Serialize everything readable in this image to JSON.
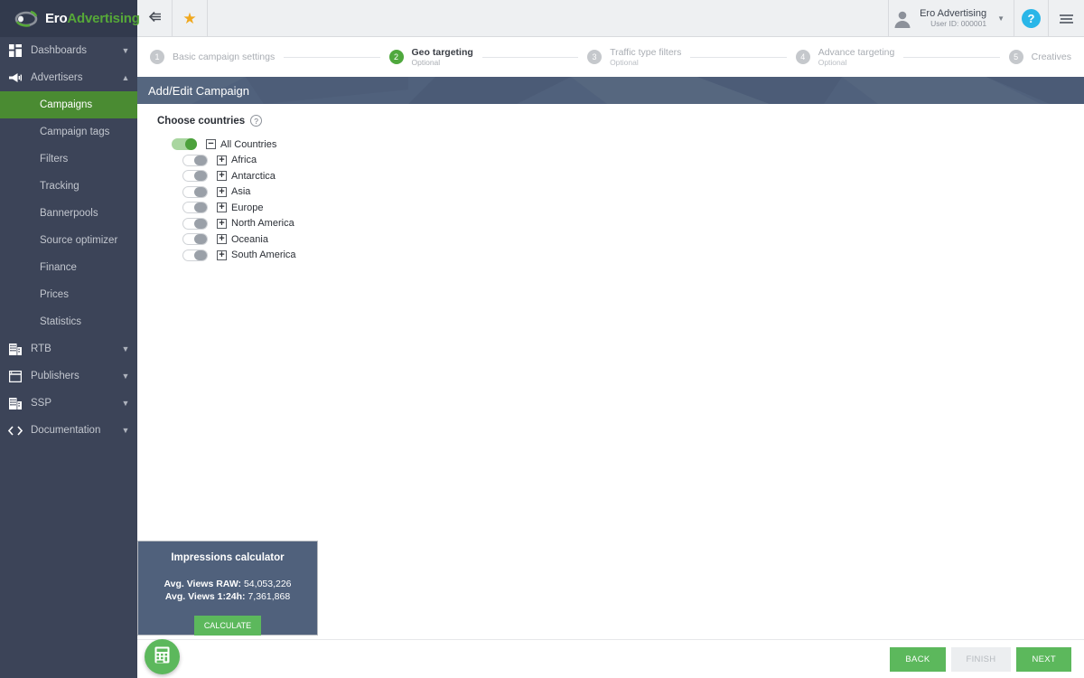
{
  "brand": {
    "name_first": "Ero",
    "name_second": "Advertising",
    "logo_icon": "eye-swoosh-logo"
  },
  "topbar": {
    "collapse_icon": "collapse-left-icon",
    "favorite_icon": "star-icon",
    "avatar_icon": "user-avatar-icon",
    "account_name": "Ero Advertising",
    "account_id": "User ID: 000001",
    "caret_icon": "chevron-down-icon",
    "help_label": "?",
    "help_icon": "help-icon",
    "menu_icon": "hamburger-menu-icon"
  },
  "sidebar": {
    "items": [
      {
        "label": "Dashboards",
        "icon": "grid-dashboard-icon",
        "chevron": "chevron-down-icon",
        "type": "group"
      },
      {
        "label": "Advertisers",
        "icon": "megaphone-icon",
        "chevron": "chevron-up-icon",
        "type": "group"
      },
      {
        "label": "Campaigns",
        "type": "sub",
        "active": true
      },
      {
        "label": "Campaign tags",
        "type": "sub",
        "active": false
      },
      {
        "label": "Filters",
        "type": "sub",
        "active": false
      },
      {
        "label": "Tracking",
        "type": "sub",
        "active": false
      },
      {
        "label": "Bannerpools",
        "type": "sub",
        "active": false
      },
      {
        "label": "Source optimizer",
        "type": "sub",
        "active": false
      },
      {
        "label": "Finance",
        "type": "sub",
        "active": false
      },
      {
        "label": "Prices",
        "type": "sub",
        "active": false
      },
      {
        "label": "Statistics",
        "type": "sub",
        "active": false
      },
      {
        "label": "RTB",
        "icon": "building-icon",
        "chevron": "chevron-down-icon",
        "type": "group"
      },
      {
        "label": "Publishers",
        "icon": "window-icon",
        "chevron": "chevron-down-icon",
        "type": "group"
      },
      {
        "label": "SSP",
        "icon": "building-icon",
        "chevron": "chevron-down-icon",
        "type": "group"
      },
      {
        "label": "Documentation",
        "icon": "code-brackets-icon",
        "chevron": "chevron-down-icon",
        "type": "group"
      }
    ]
  },
  "steps": [
    {
      "num": "1",
      "title": "Basic campaign settings",
      "sub": "",
      "state": "inactive"
    },
    {
      "num": "2",
      "title": "Geo targeting",
      "sub": "Optional",
      "state": "active"
    },
    {
      "num": "3",
      "title": "Traffic type filters",
      "sub": "Optional",
      "state": "inactive"
    },
    {
      "num": "4",
      "title": "Advance targeting",
      "sub": "Optional",
      "state": "inactive"
    },
    {
      "num": "5",
      "title": "Creatives",
      "sub": "",
      "state": "inactive"
    }
  ],
  "page": {
    "title": "Add/Edit Campaign"
  },
  "countries_section": {
    "label": "Choose countries",
    "help_icon": "question-mark-icon",
    "nodes": [
      {
        "label": "All Countries",
        "toggle": "on",
        "expander": "−",
        "child": false
      },
      {
        "label": "Africa",
        "toggle": "off",
        "expander": "+",
        "child": true
      },
      {
        "label": "Antarctica",
        "toggle": "off",
        "expander": "+",
        "child": true
      },
      {
        "label": "Asia",
        "toggle": "off",
        "expander": "+",
        "child": true
      },
      {
        "label": "Europe",
        "toggle": "off",
        "expander": "+",
        "child": true
      },
      {
        "label": "North America",
        "toggle": "off",
        "expander": "+",
        "child": true
      },
      {
        "label": "Oceania",
        "toggle": "off",
        "expander": "+",
        "child": true
      },
      {
        "label": "South America",
        "toggle": "off",
        "expander": "+",
        "child": true
      }
    ]
  },
  "calculator": {
    "title": "Impressions calculator",
    "raw_label": "Avg. Views RAW:",
    "raw_value": "54,053,226",
    "capped_label": "Avg. Views 1:24h:",
    "capped_value": "7,361,868",
    "button": "CALCULATE",
    "fab_icon": "calculator-icon"
  },
  "footer": {
    "back": "BACK",
    "finish": "FINISH",
    "next": "NEXT"
  },
  "colors": {
    "brand_green": "#56a838",
    "accent_green": "#5cb85c",
    "sidebar": "#3c4458",
    "header_dark": "#323a4d",
    "panel_slate": "#50617c",
    "help_blue": "#29b6e8",
    "star_gold": "#f0a81e"
  }
}
